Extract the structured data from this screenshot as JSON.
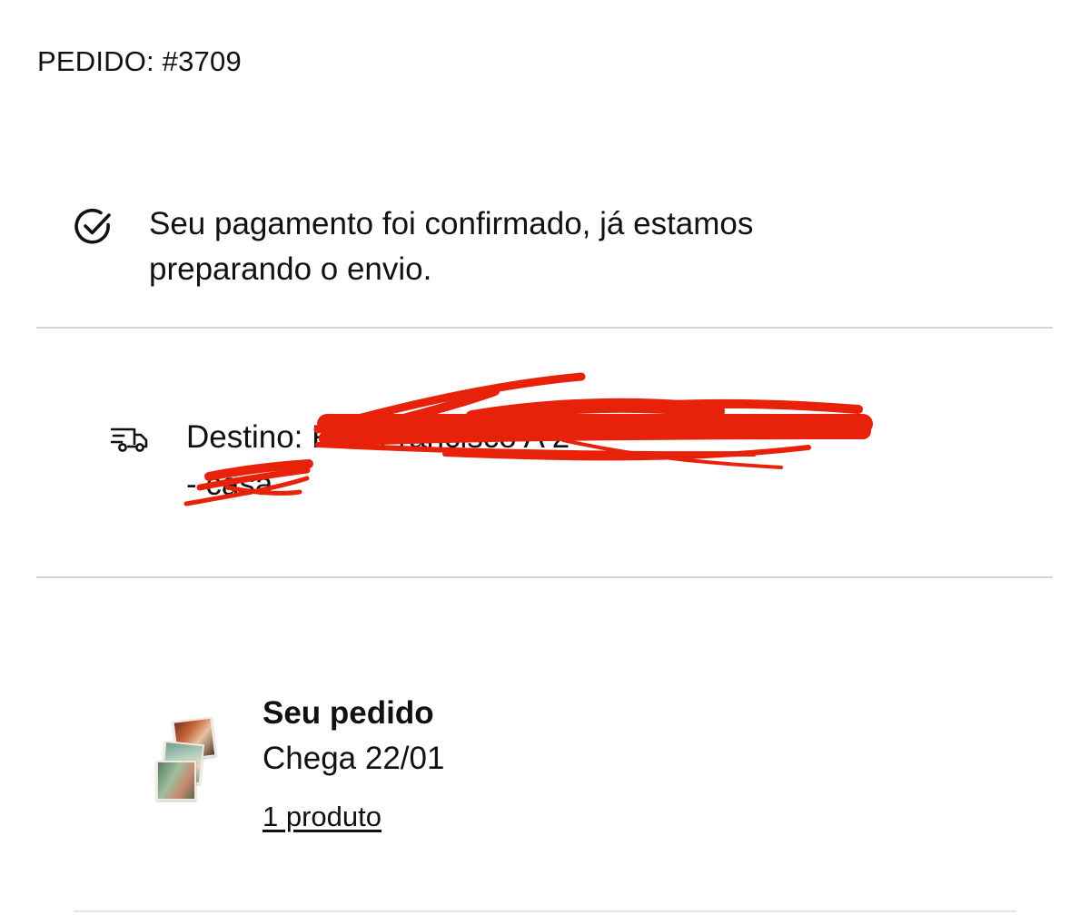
{
  "order": {
    "number_label": "PEDIDO: #3709"
  },
  "status": {
    "icon": "check-circle-icon",
    "message": "Seu pagamento foi confirmado, já estamos preparando o envio."
  },
  "destination": {
    "icon": "truck-icon",
    "text": "Destino: Rua Francisco A                 2\n- casa",
    "redaction_color": "#e8220a"
  },
  "item": {
    "title": "Seu pedido",
    "eta": "Chega 22/01",
    "link_label": "1 produto"
  }
}
